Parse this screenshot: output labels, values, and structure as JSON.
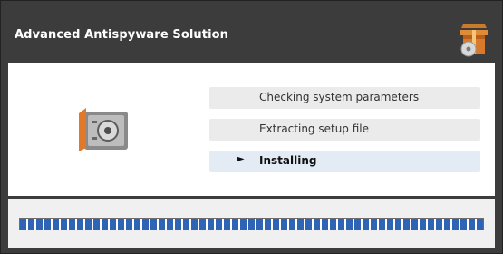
{
  "window": {
    "title": "Advanced Antispyware Solution"
  },
  "icons": {
    "header": "open-box-cd-icon",
    "logo": "safe-vault-icon"
  },
  "steps": [
    {
      "label": "Checking system parameters",
      "state": "done"
    },
    {
      "label": "Extracting setup file",
      "state": "done"
    },
    {
      "label": "Installing",
      "state": "active",
      "marker": "►"
    }
  ],
  "progress": {
    "fraction": 1.0
  },
  "colors": {
    "titlebar": "#3c3c3c",
    "active_step": "#e3ebf4",
    "step": "#ebebeb",
    "progress_fill": "#2e63b5"
  }
}
